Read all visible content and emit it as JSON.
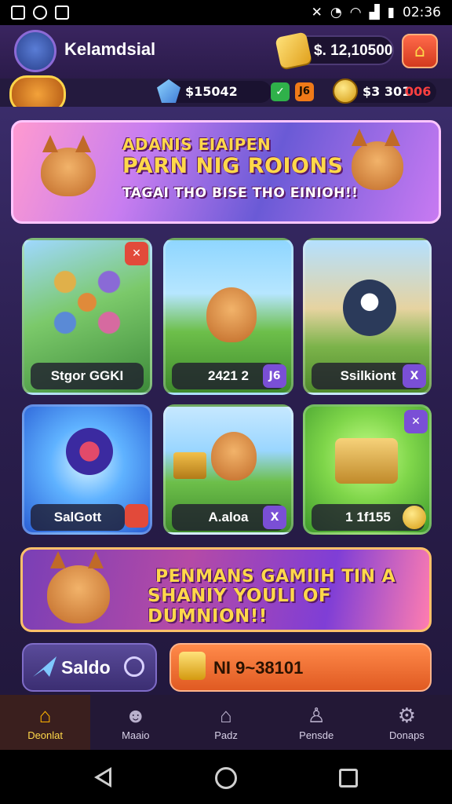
{
  "status_bar": {
    "time": "02:36"
  },
  "header": {
    "username": "Kelamdsial",
    "balance": "$. 12,10500"
  },
  "currencies": {
    "gems": "$15042",
    "chip_green": "✓",
    "chip_orange": "J6",
    "coins": "$3 301",
    "coins_extra": "006"
  },
  "top_banner": {
    "line1": "ADANIS EIAIPEN",
    "line2": "PARN NIG ROIONS",
    "line3": "TAGAI THO BISE THO EINIOH!!"
  },
  "tiles": [
    {
      "label": "Stgor GGKI",
      "badge": "✕"
    },
    {
      "label": "2421 2",
      "badge": "J6"
    },
    {
      "label": "Ssilkiont",
      "badge": "X"
    },
    {
      "label": "SalGott",
      "badge": ""
    },
    {
      "label": "A.aloa",
      "badge": "X"
    },
    {
      "label": "1 1f155",
      "badge": "✕"
    }
  ],
  "promo_banner": {
    "line1": "PENMANS GAMIIH TIN A",
    "line2": "SHANIY YOULI OF DUMNION!!"
  },
  "actions": {
    "saldo": "Saldo",
    "deposit": "NI 9~38101"
  },
  "bottom_nav": [
    {
      "label": "Deonlat",
      "icon": "home-icon"
    },
    {
      "label": "Maaio",
      "icon": "profile-icon"
    },
    {
      "label": "Padz",
      "icon": "house-icon"
    },
    {
      "label": "Pensde",
      "icon": "user-icon"
    },
    {
      "label": "Donaps",
      "icon": "gear-icon"
    }
  ]
}
